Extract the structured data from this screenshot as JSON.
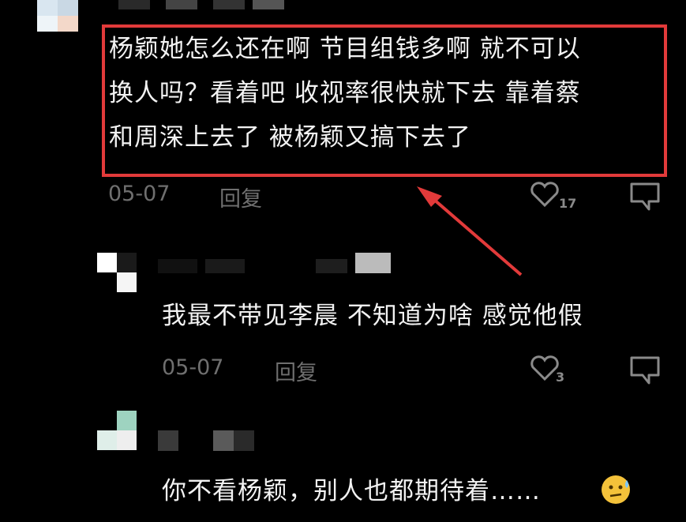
{
  "comments": [
    {
      "text_lines": [
        "杨颖她怎么还在啊 节目组钱多啊 就不可以",
        "换人吗？看着吧 收视率很快就下去  靠着蔡",
        "和周深上去了 被杨颖又搞下去了"
      ],
      "date": "05-07",
      "reply_label": "回复",
      "like_count": "17"
    },
    {
      "text": "我最不带见李晨 不知道为啥 感觉他假",
      "date": "05-07",
      "reply_label": "回复",
      "like_count": "3"
    },
    {
      "text": "你不看杨颖，别人也都期待着……"
    }
  ],
  "colors": {
    "highlight": "#e23a3a",
    "background": "#000000",
    "text": "#f2f2f2",
    "meta": "#6f6f6f"
  },
  "icons": [
    "heart-icon",
    "dislike-icon",
    "emoji-icon",
    "arrow-icon"
  ]
}
